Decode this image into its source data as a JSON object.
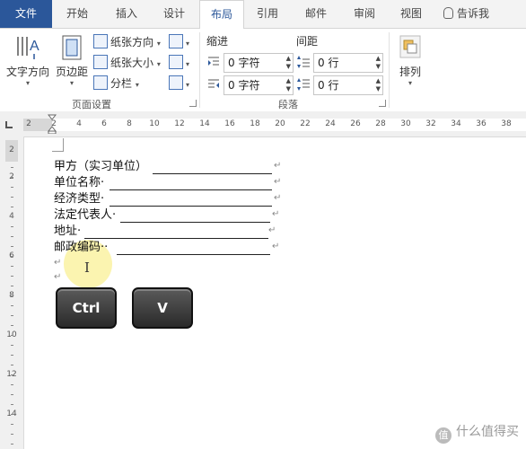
{
  "tabs": [
    "文件",
    "开始",
    "插入",
    "设计",
    "布局",
    "引用",
    "邮件",
    "审阅",
    "视图",
    "告诉我"
  ],
  "ribbon": {
    "text_direction": "文字方向",
    "margins": "页边距",
    "orientation": "纸张方向",
    "size": "纸张大小",
    "columns": "分栏",
    "page_setup_label": "页面设置",
    "indent_label": "缩进",
    "spacing_label": "间距",
    "indent_left": "0 字符",
    "indent_right": "0 字符",
    "spacing_before": "0 行",
    "spacing_after": "0 行",
    "paragraph_label": "段落",
    "arrange": "排列"
  },
  "ruler": {
    "numbers": [
      "2",
      "2",
      "4",
      "6",
      "8",
      "10",
      "12",
      "14",
      "16",
      "18",
      "20",
      "22",
      "24",
      "26",
      "28",
      "30",
      "32",
      "34",
      "36",
      "38"
    ],
    "vnumbers": [
      "2",
      "2",
      "4",
      "6",
      "8",
      "10",
      "12",
      "14"
    ]
  },
  "document": {
    "lines": [
      "甲方（实习单位）",
      "单位名称·",
      "经济类型·",
      "法定代表人·",
      "地址·",
      "邮政编码··"
    ],
    "para_mark": "↵"
  },
  "keys": {
    "ctrl": "Ctrl",
    "v": "V"
  },
  "watermark": "什么值得买",
  "watermark_logo": "值"
}
